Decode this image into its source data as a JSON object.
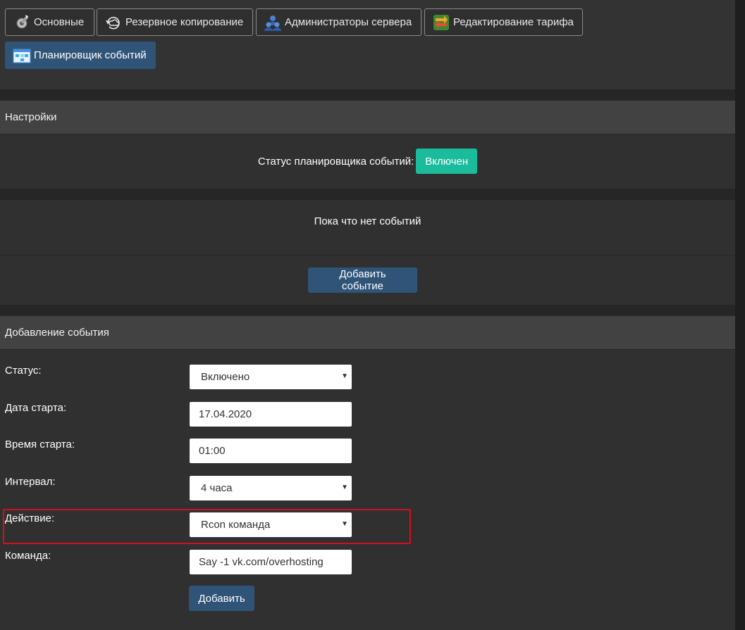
{
  "tabs": [
    {
      "label": "Основные",
      "icon": "wrench-gear-icon"
    },
    {
      "label": "Резервное копирование",
      "icon": "cloud-backup-icon"
    },
    {
      "label": "Администраторы сервера",
      "icon": "users-group-icon"
    },
    {
      "label": "Редактирование тарифа",
      "icon": "swap-arrows-icon"
    },
    {
      "label": "Планировщик событий",
      "icon": "calendar-schedule-icon",
      "active": true
    }
  ],
  "settings": {
    "title": "Настройки",
    "status_label": "Статус планировщика событий:",
    "status_value": "Включен",
    "status_color": "#1abc9c"
  },
  "events": {
    "empty_text": "Пока что нет событий",
    "add_button": "Добавить событие"
  },
  "add_event": {
    "title": "Добавление события",
    "fields": {
      "status": {
        "label": "Статус:",
        "value": "Включено"
      },
      "start_date": {
        "label": "Дата старта:",
        "value": "17.04.2020"
      },
      "start_time": {
        "label": "Время старта:",
        "value": "01:00"
      },
      "interval": {
        "label": "Интервал:",
        "value": "4 часа"
      },
      "action": {
        "label": "Действие:",
        "value": "Rcon команда"
      },
      "command": {
        "label": "Команда:",
        "value": "Say -1 vk.com/overhosting"
      }
    },
    "submit": "Добавить"
  },
  "colors": {
    "accent": "#2f5478",
    "highlight": "#d0101e",
    "background": "#2e2e2e"
  }
}
